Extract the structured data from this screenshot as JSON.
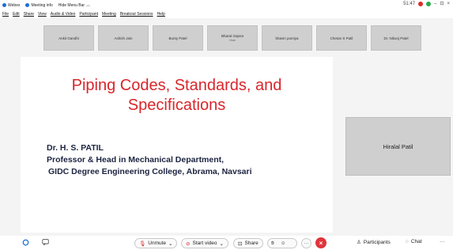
{
  "titlebar": {
    "webex": "Webex",
    "meeting_info": "Meeting info",
    "hide_menu": "Hide Menu Bar",
    "time": "51:47",
    "minimize": "–",
    "restore": "⊡",
    "close": "×"
  },
  "menu": [
    "File",
    "Edit",
    "Share",
    "View",
    "Audio & Video",
    "Participant",
    "Meeting",
    "Breakout Sessions",
    "Help"
  ],
  "participants": [
    {
      "name": "Ankit Gandhi",
      "sub": ""
    },
    {
      "name": "Ashish Jain",
      "sub": ""
    },
    {
      "name": "Bunty Patel",
      "sub": ""
    },
    {
      "name": "Bharat Gajera",
      "sub": "Host"
    },
    {
      "name": "bhavin pumiya",
      "sub": ""
    },
    {
      "name": "Chetan S Patil",
      "sub": ""
    },
    {
      "name": "Dr. Nikunj Patel",
      "sub": ""
    }
  ],
  "slide": {
    "title_line1": "Piping Codes, Standards, and",
    "title_line2": "Specifications",
    "author_line1": "Dr. H. S. PATIL",
    "author_line2": "Professor & Head in Mechanical Department,",
    "author_line3": "GIDC Degree Engineering College, Abrama, Navsari"
  },
  "speaker": {
    "name": "Hiralal Patil"
  },
  "toolbar": {
    "unmute": "Unmute",
    "start_video": "Start video",
    "share": "Share",
    "participants": "Participants",
    "chat": "Chat",
    "more": "···"
  },
  "colors": {
    "slide_title": "#d8262b",
    "slide_author": "#1c2340",
    "leave_button": "#e0343b"
  }
}
